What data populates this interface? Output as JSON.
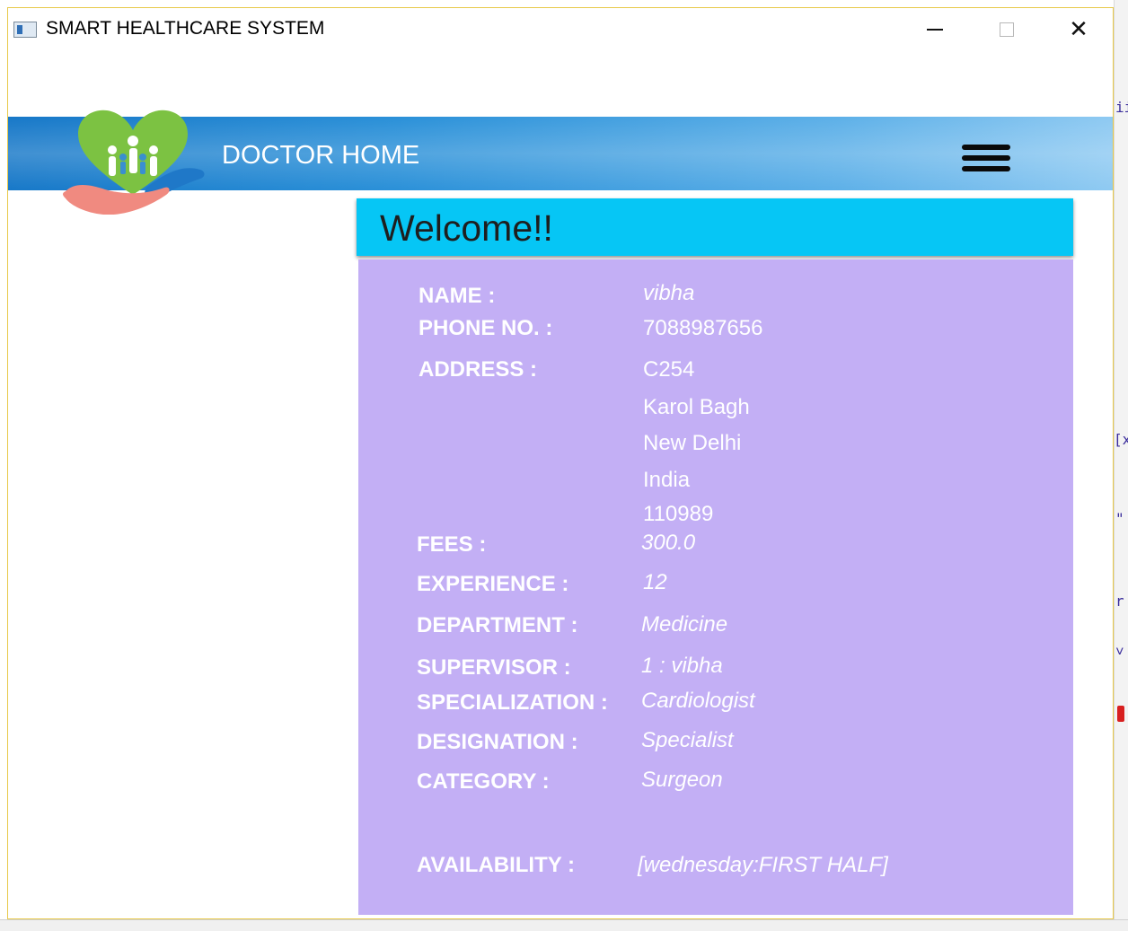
{
  "window": {
    "title": "SMART HEALTHCARE SYSTEM",
    "close_glyph": "✕"
  },
  "header": {
    "title": "DOCTOR HOME",
    "accent_color": "#2a90d8"
  },
  "welcome": {
    "text": "Welcome!!",
    "bar_color": "#06c6f5"
  },
  "profile": {
    "panel_color": "#c3aff5",
    "name_label": "NAME :",
    "name_value": "vibha",
    "phone_label": "PHONE NO. :",
    "phone_value": "7088987656",
    "address_label": "ADDRESS :",
    "address_lines": [
      "C254",
      "Karol Bagh",
      "New Delhi",
      "India",
      "110989"
    ],
    "fees_label": "FEES :",
    "fees_value": "300.0",
    "experience_label": "EXPERIENCE :",
    "experience_value": "12",
    "department_label": "DEPARTMENT :",
    "department_value": "Medicine",
    "supervisor_label": "SUPERVISOR :",
    "supervisor_value": "1 : vibha",
    "specialization_label": "SPECIALIZATION :",
    "specialization_value": "Cardiologist",
    "designation_label": "DESIGNATION :",
    "designation_value": "Specialist",
    "category_label": "CATEGORY :",
    "category_value": "Surgeon",
    "availability_label": "AVAILABILITY :",
    "availability_value": "[wednesday:FIRST HALF]"
  }
}
